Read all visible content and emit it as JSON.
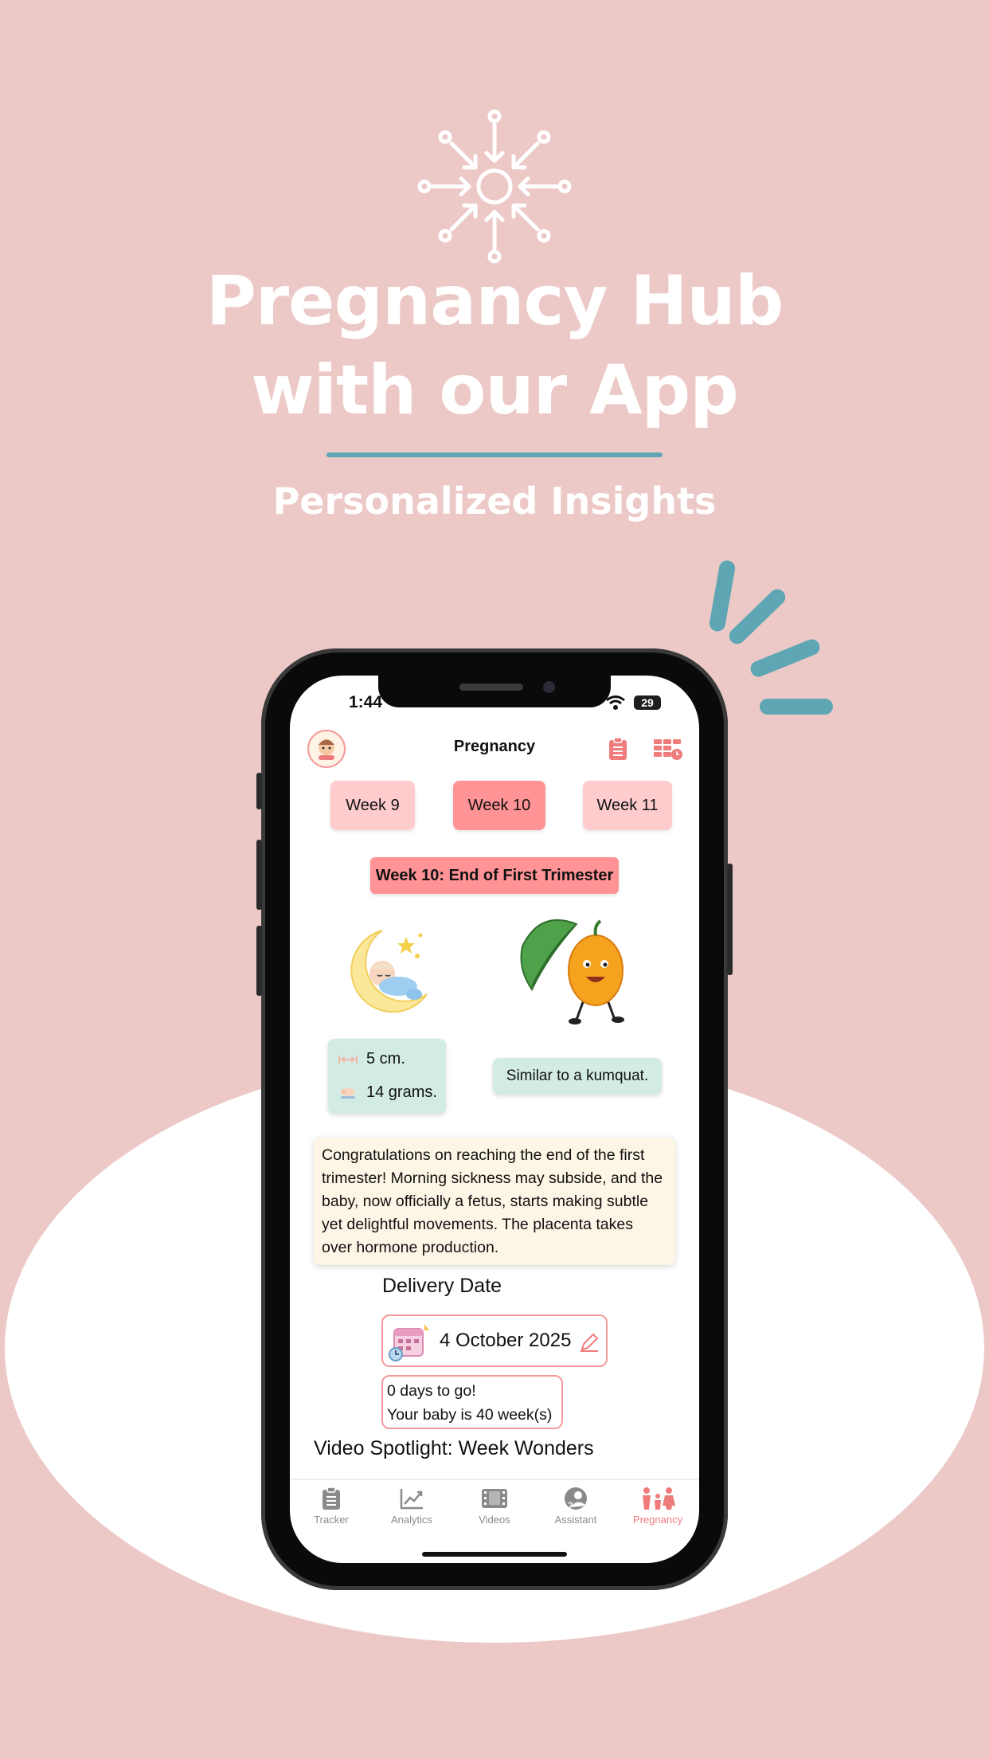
{
  "hero": {
    "title_line1": "Pregnancy Hub",
    "title_line2": "with our App",
    "subtitle": "Personalized Insights",
    "icon": "sun-arrows-icon",
    "accent_color": "#5ea6b4",
    "background_color": "#ecc9c7"
  },
  "status_bar": {
    "time": "1:44",
    "battery": "29"
  },
  "app": {
    "title": "Pregnancy",
    "left_icon": "baby-logo-icon",
    "right_icons": [
      "clipboard-icon",
      "grid-calendar-icon"
    ]
  },
  "weeks": [
    {
      "label": "Week 9",
      "active": false
    },
    {
      "label": "Week 10",
      "active": true
    },
    {
      "label": "Week 11",
      "active": false
    }
  ],
  "week_title": "Week 10: End of First Trimester",
  "stats": {
    "length": "5 cm.",
    "weight": "14 grams."
  },
  "comparison": "Similar to a kumquat.",
  "description": "Congratulations on reaching the end of the first trimester! Morning sickness may subside, and the baby, now officially a fetus, starts making subtle yet delightful movements. The placenta takes over hormone production.",
  "delivery": {
    "label": "Delivery Date",
    "date": "4 October 2025",
    "days_to_go": "0 days to go!",
    "baby_age": "Your baby is 40 week(s)"
  },
  "video_spotlight": "Video Spotlight: Week Wonders",
  "tabbar": [
    {
      "label": "Tracker",
      "icon": "clipboard-icon",
      "active": false
    },
    {
      "label": "Analytics",
      "icon": "chart-icon",
      "active": false
    },
    {
      "label": "Videos",
      "icon": "film-icon",
      "active": false
    },
    {
      "label": "Assistant",
      "icon": "assistant-icon",
      "active": false
    },
    {
      "label": "Pregnancy",
      "icon": "family-icon",
      "active": true
    }
  ]
}
